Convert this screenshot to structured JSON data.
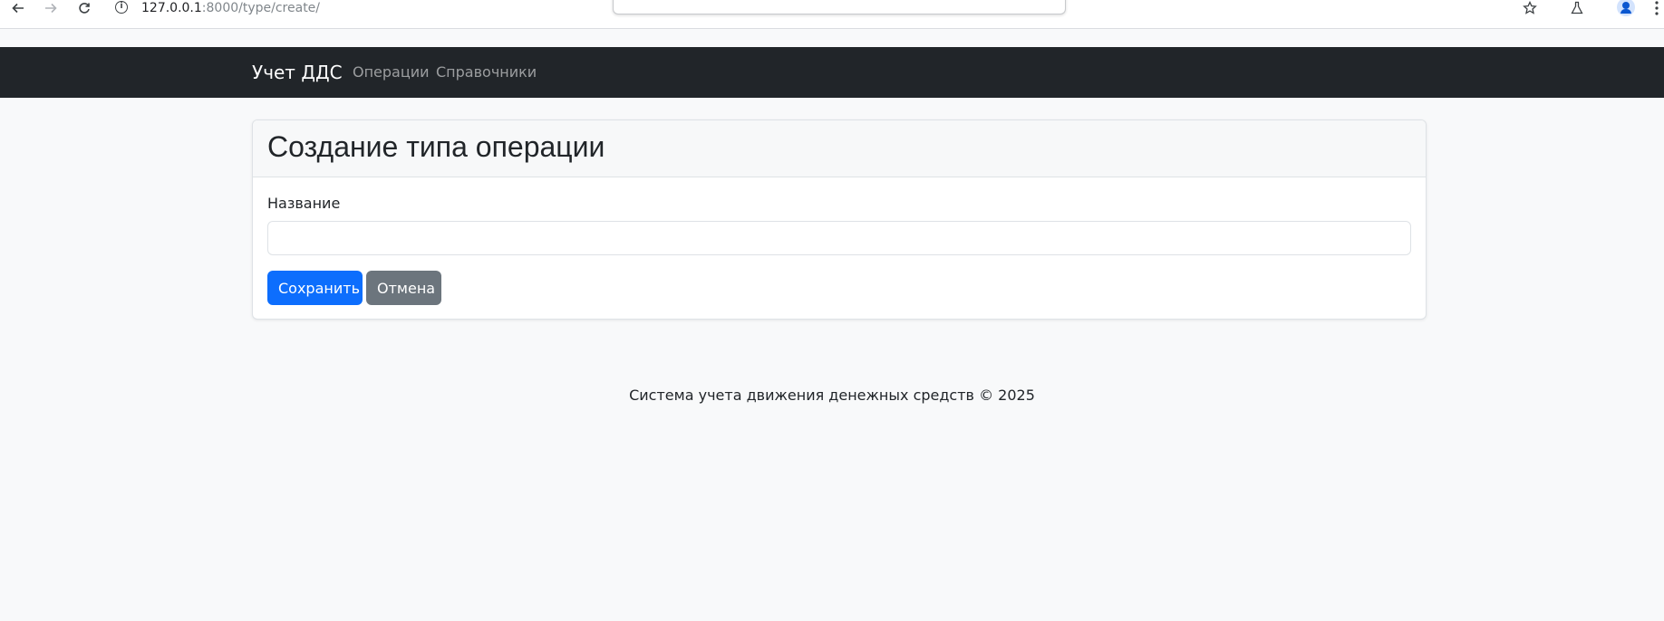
{
  "browser": {
    "url_host": "127.0.0.1",
    "url_path": ":8000/type/create/",
    "icons": [
      "back-arrow-icon",
      "forward-arrow-icon",
      "reload-icon",
      "site-info-icon",
      "bookmark-star-icon",
      "labs-flask-icon",
      "profile-icon",
      "more-menu-icon"
    ]
  },
  "navbar": {
    "brand": "Учет ДДС",
    "links": [
      {
        "label": "Операции"
      },
      {
        "label": "Справочники"
      }
    ]
  },
  "card": {
    "title": "Создание типа операции",
    "field": {
      "label": "Название",
      "value": "",
      "placeholder": ""
    },
    "buttons": {
      "save": "Сохранить",
      "cancel": "Отмена"
    }
  },
  "footer": {
    "text": "Система учета движения денежных средств © 2025"
  },
  "colors": {
    "navbar_bg": "#212529",
    "primary": "#0d6efd",
    "secondary": "#6c757d",
    "page_bg": "#f8f9fa"
  }
}
